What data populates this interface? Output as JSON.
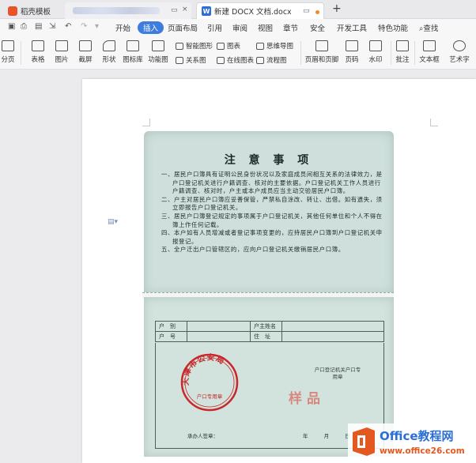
{
  "tabs": {
    "home_label": "稻壳模板",
    "doc_label": "新建 DOCX 文档.docx"
  },
  "menu": {
    "items": [
      "开始",
      "插入",
      "页面布局",
      "引用",
      "审阅",
      "视图",
      "章节",
      "安全",
      "开发工具",
      "特色功能"
    ],
    "active": "插入",
    "search_label": "查找"
  },
  "ribbon": {
    "large": [
      "表格",
      "图片",
      "截屏",
      "形状",
      "图标库",
      "功能图",
      "页眉和页脚",
      "页码",
      "水印",
      "批注",
      "文本框",
      "艺术字"
    ],
    "small": [
      "智能图形",
      "图表",
      "思维导图",
      "关系图",
      "在线图表",
      "流程图"
    ],
    "cut_label": "分页"
  },
  "document": {
    "title": "注 意 事 项",
    "items": [
      "一、居民户口簿具有证明公民身份状况以及家庭成员间相互关系的法律效力，是户口登记机关进行户籍调查、核对的主要依据。户口登记机关工作人员进行户籍调查、核对时，户主或本户成员应当主动交验居民户口簿。",
      "二、户主对居民户口簿应妥善保管，严禁私自涂改、转让、出借。如有遗失，须立即报告户口登记机关。",
      "三、居民户口簿登记规定的事项属于户口登记机关，其他任何单位和个人不得在簿上作任何记载。",
      "四、本户如有人员增减或者登记事项变更的，应持居民户口簿到户口登记机关申报登记。",
      "五、全户迁出户口管辖区的，应向户口登记机关缴销居民户口簿。"
    ],
    "register": {
      "row1": [
        "户　别",
        "",
        "户主姓名",
        ""
      ],
      "row2": [
        "户　号",
        "",
        "住　址",
        ""
      ]
    },
    "stamp_text": "天津市公安局",
    "stamp_inner": "户口专用章",
    "seal_label": "户口登记机关户口专用章",
    "sample": "样品",
    "signer": "承办人签章：",
    "date": "年 月 日"
  },
  "watermark": {
    "brand": "Office教程网",
    "url": "www.office26.com"
  },
  "colors": {
    "accent": "#3e7ce0",
    "stamp_red": "#c8282a",
    "brand_blue": "#2b6fd6",
    "brand_orange": "#e4571f"
  }
}
